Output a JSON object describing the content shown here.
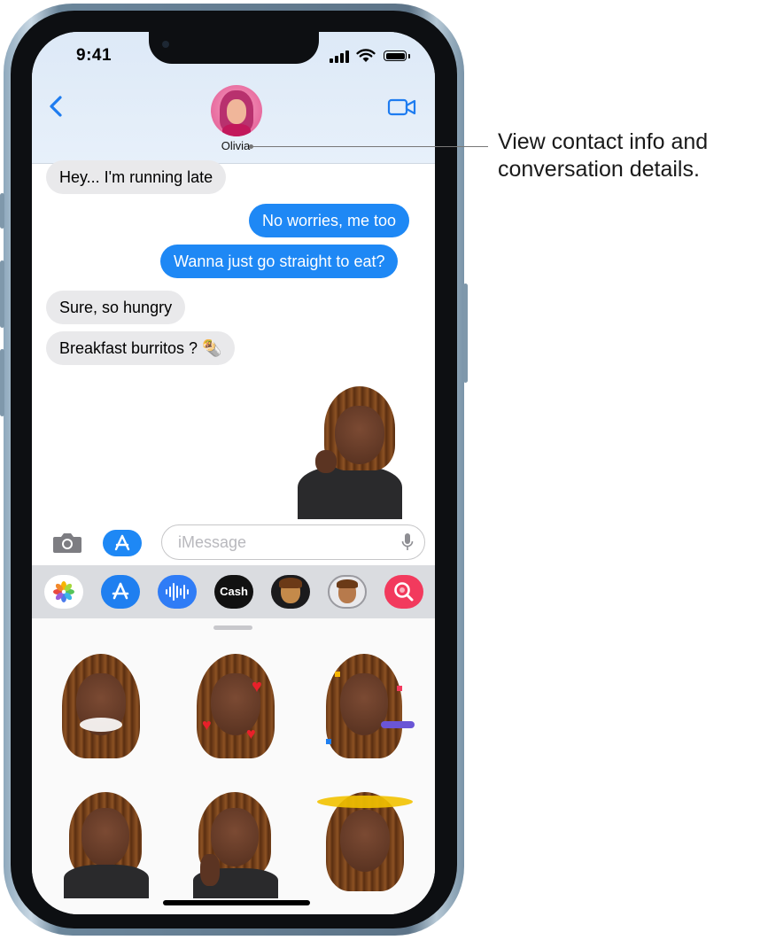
{
  "status_bar": {
    "time": "9:41"
  },
  "header": {
    "back_icon": "chevron-left-icon",
    "contact_name": "Olivia",
    "video_icon": "video-camera-icon"
  },
  "messages": [
    {
      "from": "them",
      "text": "Hey... I'm running late"
    },
    {
      "from": "me",
      "text": "No worries, me too"
    },
    {
      "from": "me",
      "text": "Wanna just go straight to eat?"
    },
    {
      "from": "them",
      "text": "Sure, so hungry"
    },
    {
      "from": "them",
      "text": "Breakfast burritos ? 🌯"
    }
  ],
  "compose": {
    "camera_icon": "camera-icon",
    "apps_icon": "app-store-icon",
    "placeholder": "iMessage",
    "mic_icon": "microphone-icon"
  },
  "app_drawer": {
    "apps": [
      {
        "name": "photos-icon",
        "label": ""
      },
      {
        "name": "app-store-icon",
        "label": ""
      },
      {
        "name": "audio-waveform-icon",
        "label": ""
      },
      {
        "name": "apple-cash-icon",
        "label": "Cash"
      },
      {
        "name": "memoji-icon",
        "label": ""
      },
      {
        "name": "memoji-stickers-icon",
        "label": ""
      },
      {
        "name": "search-images-icon",
        "label": ""
      }
    ]
  },
  "callout": {
    "text": "View contact info and conversation details."
  },
  "colors": {
    "bubble_out": "#1e88f5",
    "bubble_in": "#e9e9eb",
    "header": "#e3edf8"
  }
}
